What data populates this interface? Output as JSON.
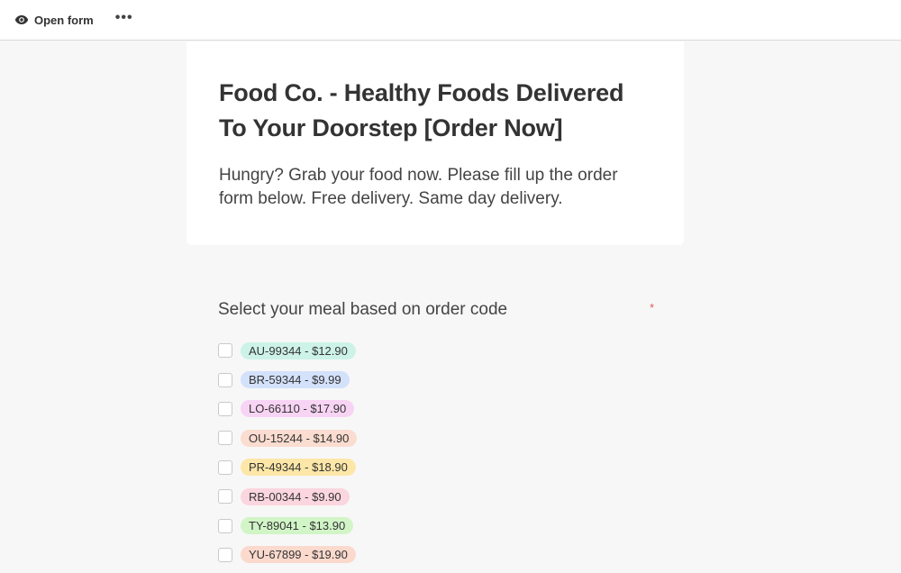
{
  "toolbar": {
    "open_form_label": "Open form",
    "more_label": "•••",
    "eye_icon": "eye-icon",
    "more_icon": "more-horizontal-icon"
  },
  "form": {
    "title": "Food Co. - Healthy Foods Delivered To Your Doorstep [Order Now]",
    "description": "Hungry? Grab your food now. Please fill up the order form below. Free delivery. Same day delivery."
  },
  "question": {
    "label": "Select your meal based on order code",
    "required_marker": "*",
    "options": [
      {
        "label": "AU-99344 - $12.90",
        "color": "#cdf2e8"
      },
      {
        "label": "BR-59344 - $9.99",
        "color": "#d3e1fb"
      },
      {
        "label": "LO-66110 - $17.90",
        "color": "#f8d4f4"
      },
      {
        "label": "OU-15244 - $14.90",
        "color": "#fbdcd0"
      },
      {
        "label": "PR-49344 - $18.90",
        "color": "#fde7a8"
      },
      {
        "label": "RB-00344 - $9.90",
        "color": "#fbd6df"
      },
      {
        "label": "TY-89041 - $13.90",
        "color": "#d2f5c8"
      },
      {
        "label": "YU-67899 - $19.90",
        "color": "#fbd9cd"
      }
    ]
  }
}
